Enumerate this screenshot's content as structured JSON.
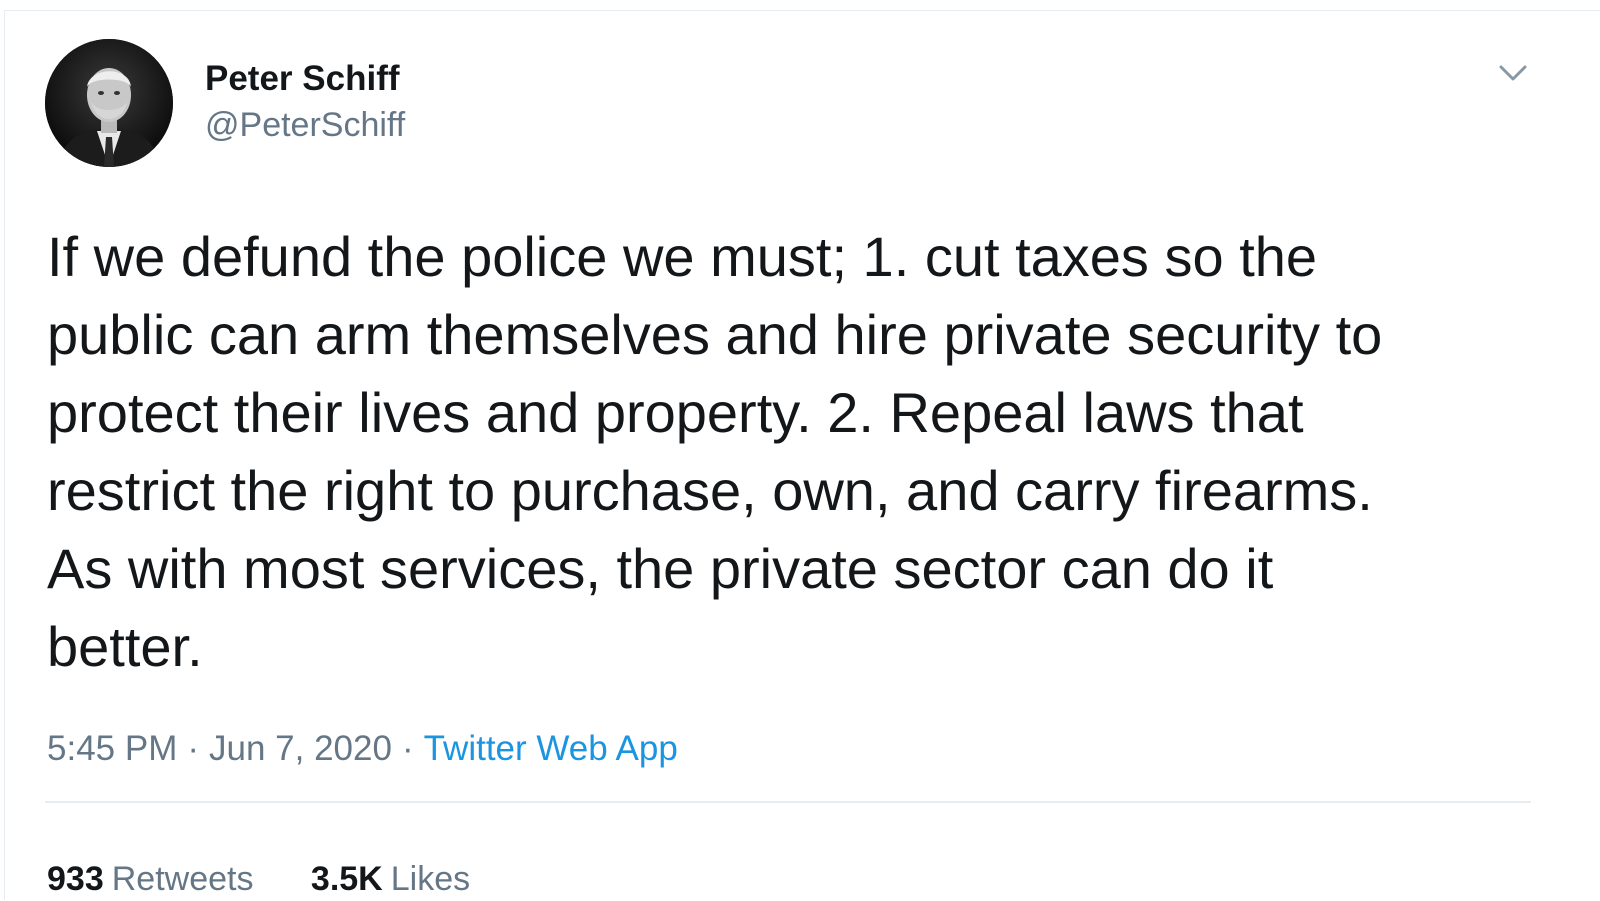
{
  "author": {
    "display_name": "Peter Schiff",
    "handle": "@PeterSchiff"
  },
  "tweet": {
    "text": "If we defund the police we must; 1. cut taxes so the\npublic can arm themselves and hire private security to\nprotect their lives and property. 2. Repeal laws that\nrestrict the right to purchase, own, and carry firearms.\nAs with most services, the private sector can do it\nbetter."
  },
  "meta": {
    "time": "5:45 PM",
    "separator": "·",
    "date": "Jun 7, 2020",
    "source": "Twitter Web App"
  },
  "stats": {
    "retweets_count": "933",
    "retweets_label": "Retweets",
    "likes_count": "3.5K",
    "likes_label": "Likes"
  },
  "icons": {
    "menu": "chevron-down-icon"
  },
  "colors": {
    "text_primary": "#14171a",
    "text_secondary": "#657786",
    "link": "#1b95e0",
    "divider": "#e6ecf0"
  }
}
